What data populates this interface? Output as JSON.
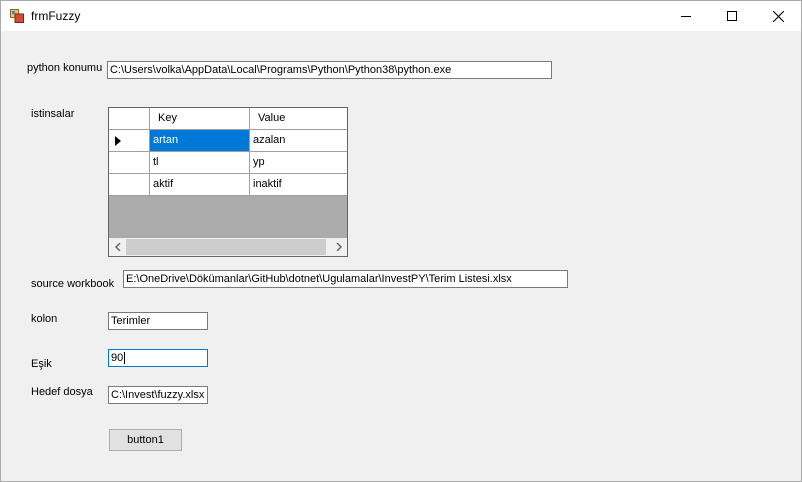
{
  "window": {
    "title": "frmFuzzy",
    "icon": "winforms-app-icon",
    "controls": [
      "minimize-icon",
      "maximize-icon",
      "close-icon"
    ]
  },
  "form": {
    "python_label": "python konumu",
    "python_value": "C:\\Users\\volka\\AppData\\Local\\Programs\\Python\\Python38\\python.exe",
    "istinsalar_label": "istinsalar",
    "grid": {
      "columns": [
        "Key",
        "Value"
      ],
      "rows": [
        {
          "key": "artan",
          "value": "azalan"
        },
        {
          "key": "tl",
          "value": "yp"
        },
        {
          "key": "aktif",
          "value": "inaktif"
        }
      ],
      "selected_row": 0
    },
    "source_label": "source workbook",
    "source_value": "E:\\OneDrive\\Dökümanlar\\GitHub\\dotnet\\Ugulamalar\\InvestPY\\Terim Listesi.xlsx",
    "kolon_label": "kolon",
    "kolon_value": "Terimler",
    "esik_label": "Eşik",
    "esik_value": "90",
    "hedef_label": "Hedef dosya",
    "hedef_value": "C:\\Invest\\fuzzy.xlsx",
    "button_label": "button1"
  },
  "colors": {
    "accent": "#0078d7",
    "grid_background": "#ababab",
    "form_background": "#f0f0f0"
  }
}
